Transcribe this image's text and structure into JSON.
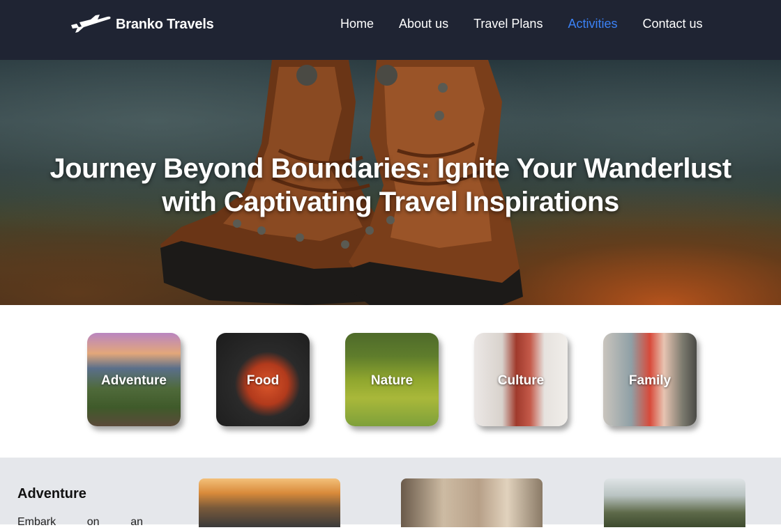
{
  "brand": {
    "name": "Branko Travels",
    "logo_icon": "airplane-icon"
  },
  "nav": {
    "items": [
      {
        "label": "Home",
        "active": false
      },
      {
        "label": "About us",
        "active": false
      },
      {
        "label": "Travel Plans",
        "active": false
      },
      {
        "label": "Activities",
        "active": true
      },
      {
        "label": "Contact us",
        "active": false
      }
    ],
    "active_color": "#3b82f6"
  },
  "hero": {
    "title": "Journey Beyond Boundaries: Ignite Your Wanderlust with Captivating Travel Inspirations"
  },
  "categories": [
    {
      "label": "Adventure"
    },
    {
      "label": "Food"
    },
    {
      "label": "Nature"
    },
    {
      "label": "Culture"
    },
    {
      "label": "Family"
    }
  ],
  "section": {
    "title": "Adventure",
    "text": "Embark on an"
  },
  "colors": {
    "header_bg": "#1f2433",
    "section_bg": "#e5e7eb"
  }
}
